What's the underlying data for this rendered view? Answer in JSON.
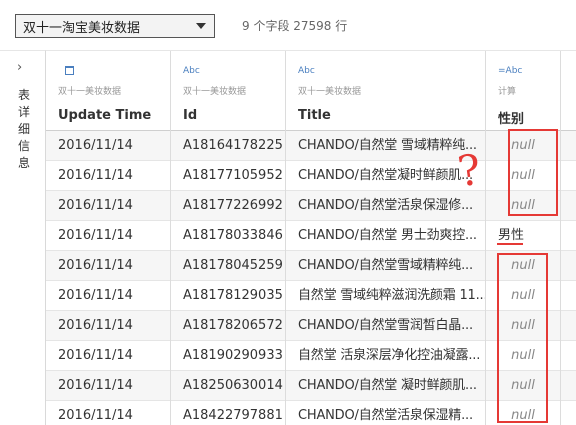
{
  "datasource": {
    "name": "双十一淘宝美妆数据",
    "summary": "9 个字段 27598 行"
  },
  "rail": {
    "label": "表详细信息",
    "chevron": "›"
  },
  "columns": [
    {
      "type": "calendar-icon",
      "source": "双十一美妆数据",
      "name": "Update Time"
    },
    {
      "type": "Abc",
      "source": "双十一美妆数据",
      "name": "Id"
    },
    {
      "type": "Abc",
      "source": "双十一美妆数据",
      "name": "Title"
    },
    {
      "type": "=Abc",
      "source": "计算",
      "name": "性别"
    }
  ],
  "rows": [
    {
      "date": "2016/11/14",
      "id": "A18164178225",
      "title": "CHANDO/自然堂 雪域精粹纯...",
      "gender": "null"
    },
    {
      "date": "2016/11/14",
      "id": "A18177105952",
      "title": "CHANDO/自然堂凝时鲜颜肌...",
      "gender": "null"
    },
    {
      "date": "2016/11/14",
      "id": "A18177226992",
      "title": "CHANDO/自然堂活泉保湿修...",
      "gender": "null"
    },
    {
      "date": "2016/11/14",
      "id": "A18178033846",
      "title": "CHANDO/自然堂 男士劲爽控...",
      "gender": "男性"
    },
    {
      "date": "2016/11/14",
      "id": "A18178045259",
      "title": "CHANDO/自然堂雪域精粹纯...",
      "gender": "null"
    },
    {
      "date": "2016/11/14",
      "id": "A18178129035",
      "title": "自然堂 雪域纯粹滋润洗颜霜 11...",
      "gender": "null"
    },
    {
      "date": "2016/11/14",
      "id": "A18178206572",
      "title": "CHANDO/自然堂雪润皙白晶...",
      "gender": "null"
    },
    {
      "date": "2016/11/14",
      "id": "A18190290933",
      "title": "自然堂 活泉深层净化控油凝露...",
      "gender": "null"
    },
    {
      "date": "2016/11/14",
      "id": "A18250630014",
      "title": "CHANDO/自然堂 凝时鲜颜肌...",
      "gender": "null"
    },
    {
      "date": "2016/11/14",
      "id": "A18422797881",
      "title": "CHANDO/自然堂活泉保湿精...",
      "gender": "null"
    }
  ],
  "annotations": {
    "question_mark": "?"
  },
  "colors": {
    "annotation": "#e53935",
    "type_icon": "#4a7fbf"
  }
}
